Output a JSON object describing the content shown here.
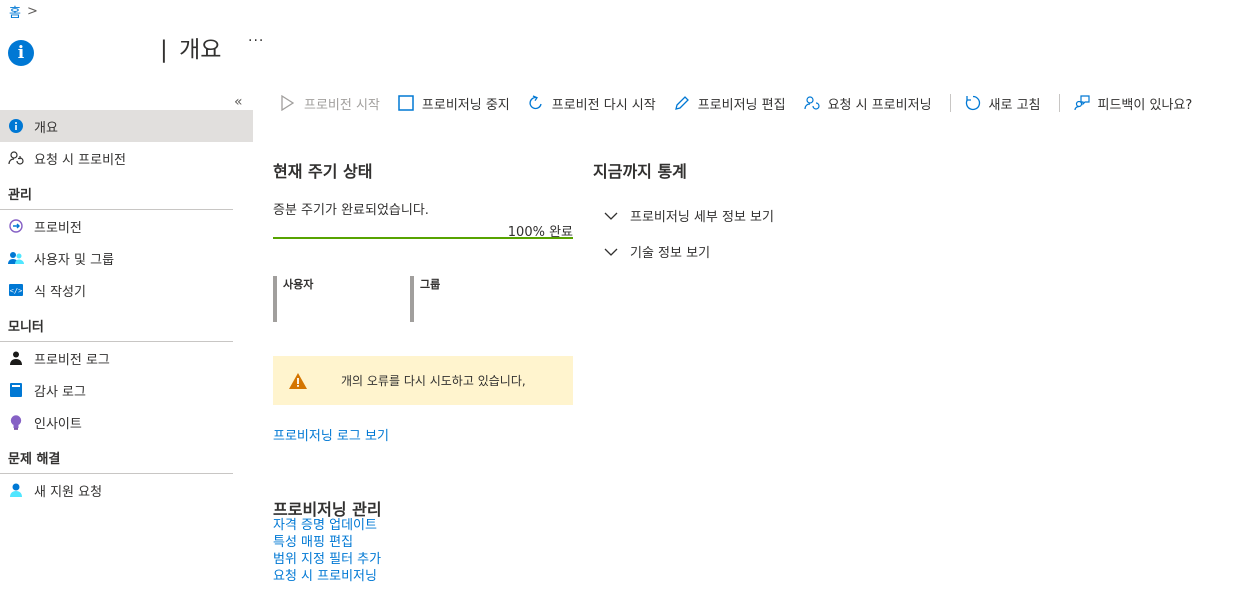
{
  "breadcrumb": {
    "home": "홈",
    "separator": ">"
  },
  "header": {
    "title_bar": "|",
    "title": "개요",
    "more": "···"
  },
  "sidebar": {
    "collapse": "«",
    "top_items": [
      {
        "label": "개요",
        "icon": "info-icon"
      },
      {
        "label": "요청 시 프로비전",
        "icon": "provision-on-demand-icon"
      }
    ],
    "sections": [
      {
        "title": "관리",
        "items": [
          {
            "label": "프로비전",
            "icon": "provisioning-icon"
          },
          {
            "label": "사용자 및 그룹",
            "icon": "users-groups-icon"
          },
          {
            "label": "식 작성기",
            "icon": "expression-builder-icon"
          }
        ]
      },
      {
        "title": "모니터",
        "items": [
          {
            "label": "프로비전 로그",
            "icon": "provisioning-logs-icon"
          },
          {
            "label": "감사 로그",
            "icon": "audit-logs-icon"
          },
          {
            "label": "인사이트",
            "icon": "insights-icon"
          }
        ]
      },
      {
        "title": "문제 해결",
        "items": [
          {
            "label": "새 지원 요청",
            "icon": "support-request-icon"
          }
        ]
      }
    ]
  },
  "commandbar": {
    "start": "프로비전 시작",
    "stop": "프로비저닝 중지",
    "restart": "프로비전 다시 시작",
    "edit": "프로비저닝 편집",
    "on_demand": "요청 시 프로비저닝",
    "refresh": "새로 고침",
    "feedback": "피드백이 있나요?"
  },
  "cycle": {
    "title": "현재 주기 상태",
    "status_text": "증분 주기가 완료되었습니다.",
    "progress_label": "100% 완료",
    "progress_percent": 100
  },
  "tiles": {
    "users": "사용자",
    "groups": "그룹"
  },
  "warning": {
    "text": "개의 오류를 다시 시도하고 있습니다,"
  },
  "log_link": "프로비저닝 로그 보기",
  "manage": {
    "title": "프로비저닝 관리",
    "links": [
      "자격 증명 업데이트",
      "특성 매핑 편집",
      "범위 지정 필터 추가",
      "요청 시 프로비저닝"
    ]
  },
  "stats": {
    "title": "지금까지 통계",
    "expanders": [
      "프로비저닝 세부 정보 보기",
      "기술 정보 보기"
    ]
  },
  "colors": {
    "accent": "#0078d4",
    "progress": "#57a300",
    "warning_bg": "#fff4ce",
    "warning_icon": "#d47500",
    "active_nav": "#e1dfdd"
  }
}
